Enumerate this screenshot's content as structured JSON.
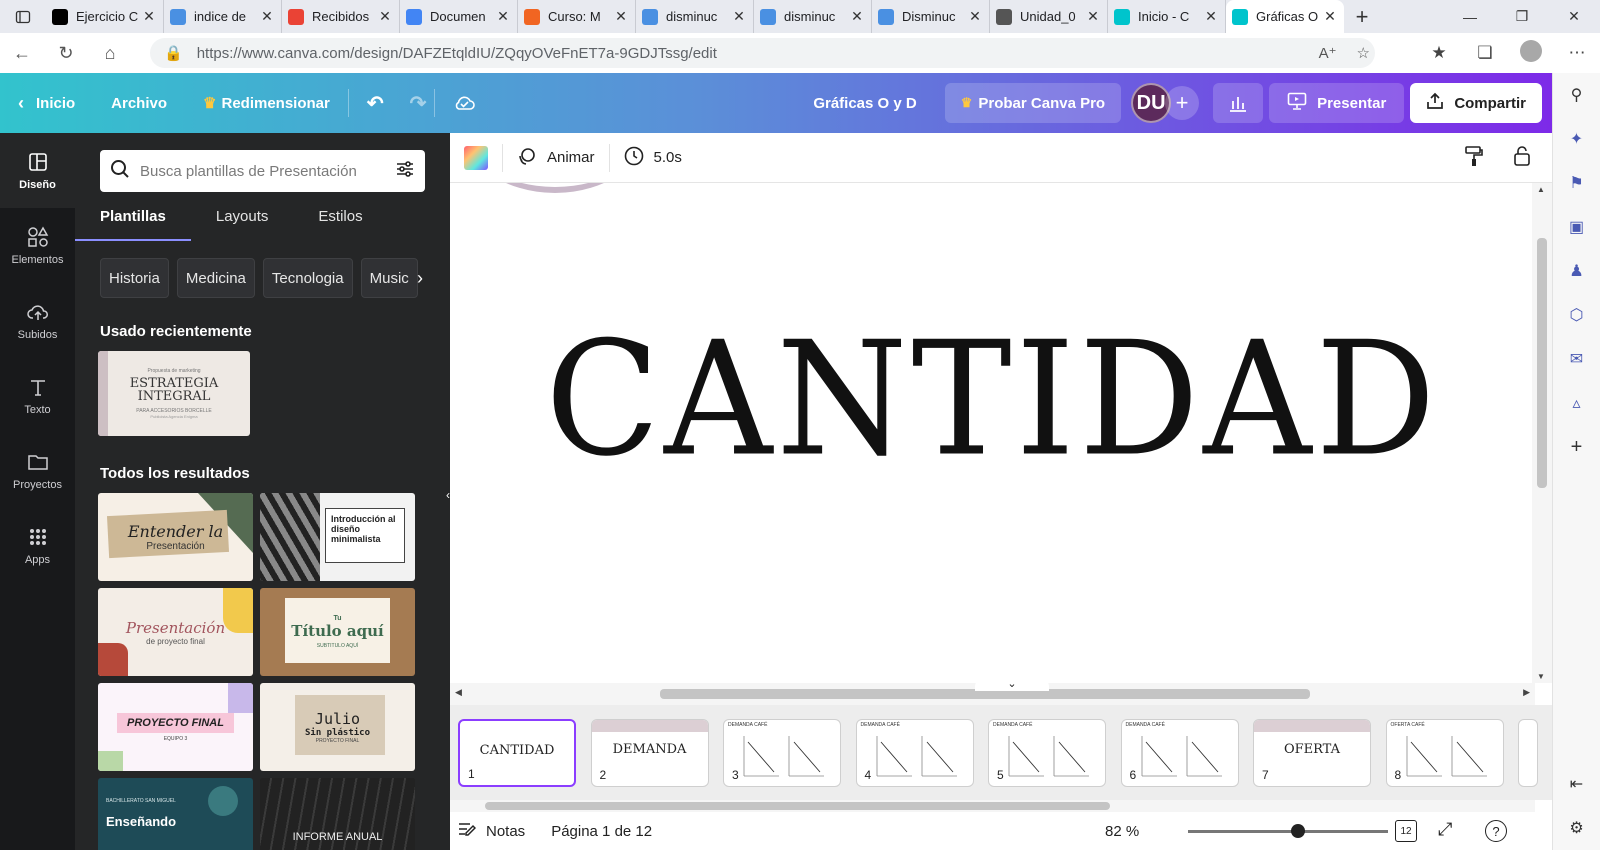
{
  "browser": {
    "tabs": [
      {
        "label": "Ejercicio C",
        "icon": "wix-icon",
        "color": "#000000"
      },
      {
        "label": "indice de",
        "icon": "search-icon",
        "color": "#4a90e2"
      },
      {
        "label": "Recibidos",
        "icon": "gmail-icon",
        "color": "#ea4335"
      },
      {
        "label": "Documen",
        "icon": "docs-icon",
        "color": "#4285f4"
      },
      {
        "label": "Curso: M",
        "icon": "moodle-icon",
        "color": "#f16522"
      },
      {
        "label": "disminuc",
        "icon": "search-icon",
        "color": "#4a90e2"
      },
      {
        "label": "disminuc",
        "icon": "search-icon",
        "color": "#4a90e2"
      },
      {
        "label": "Disminuc",
        "icon": "search-icon",
        "color": "#4a90e2"
      },
      {
        "label": "Unidad_0",
        "icon": "file-icon",
        "color": "#555555"
      },
      {
        "label": "Inicio - C",
        "icon": "canva-icon",
        "color": "#00c4cc"
      },
      {
        "label": "Gráficas O",
        "icon": "canva-icon",
        "color": "#00c4cc",
        "active": true
      }
    ],
    "url": "https://www.canva.com/design/DAFZEtqldIU/ZQqyOVeFnET7a-9GDJTssg/edit"
  },
  "header": {
    "home": "Inicio",
    "file": "Archivo",
    "resize": "Redimensionar",
    "title": "Gráficas O y D",
    "pro": "Probar Canva Pro",
    "avatar": "DU",
    "present": "Presentar",
    "share": "Compartir"
  },
  "rail": [
    {
      "label": "Diseño",
      "icon": "layout-icon"
    },
    {
      "label": "Elementos",
      "icon": "shapes-icon"
    },
    {
      "label": "Subidos",
      "icon": "upload-cloud-icon"
    },
    {
      "label": "Texto",
      "icon": "text-icon"
    },
    {
      "label": "Proyectos",
      "icon": "folder-icon"
    },
    {
      "label": "Apps",
      "icon": "apps-grid-icon"
    }
  ],
  "panel": {
    "search_placeholder": "Busca plantillas de Presentación",
    "tabs": [
      "Plantillas",
      "Layouts",
      "Estilos"
    ],
    "chips": [
      "Historia",
      "Medicina",
      "Tecnologia",
      "Music"
    ],
    "recent_title": "Usado recientemente",
    "recent": {
      "small": "Propuesta de marketing",
      "title1": "ESTRATEGIA",
      "title2": "INTEGRAL",
      "sub": "PARA ACCESORIOS BORCELLE",
      "sub2": "Publicista Agencia Enigma"
    },
    "results_title": "Todos los resultados",
    "templates": [
      {
        "text": "Entender la",
        "text2": "Presentación"
      },
      {
        "text": "Introducción al diseño minimalista"
      },
      {
        "text": "Presentación",
        "text2": "de proyecto final"
      },
      {
        "text": "Tu",
        "text2": "Título aquí",
        "text3": "SUBTITULO AQUÍ"
      },
      {
        "text": "PROYECTO FINAL",
        "text2": "EQUIPO 3"
      },
      {
        "text": "Julio",
        "text2": "Sin plástico",
        "text3": "PROYECTO FINAL"
      },
      {
        "text": "BACHILLERATO SAN MIGUEL",
        "text2": "Enseñando"
      },
      {
        "text": "INFORME ANUAL"
      }
    ]
  },
  "toolbar": {
    "animate": "Animar",
    "duration": "5.0s"
  },
  "canvas": {
    "text": "CANTIDAD"
  },
  "pages": [
    {
      "num": "1",
      "text": "CANTIDAD",
      "selected": true
    },
    {
      "num": "2",
      "text": "DEMANDA"
    },
    {
      "num": "3",
      "text": "DEMANDA CAFÉ"
    },
    {
      "num": "4",
      "text": "DEMANDA CAFÉ"
    },
    {
      "num": "5",
      "text": "DEMANDA CAFÉ"
    },
    {
      "num": "6",
      "text": "DEMANDA CAFÉ"
    },
    {
      "num": "7",
      "text": "OFERTA"
    },
    {
      "num": "8",
      "text": "OFERTA CAFÉ"
    }
  ],
  "footer": {
    "notes": "Notas",
    "page": "Página 1 de 12",
    "zoom": "82 %",
    "page_count": "12",
    "zoom_level": 0.55
  },
  "colors": {
    "accent": "#8b3dff",
    "panel": "#252627",
    "rail": "#18191b"
  }
}
